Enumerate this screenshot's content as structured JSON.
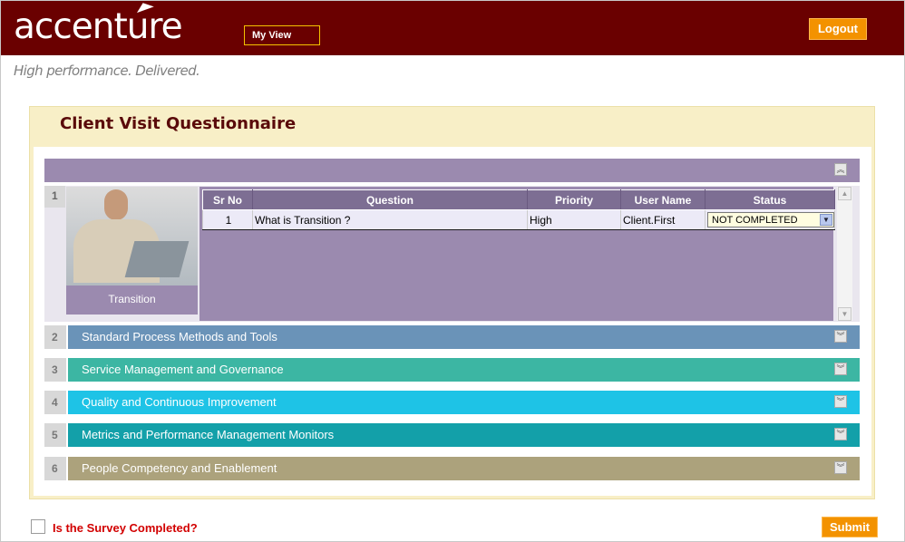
{
  "header": {
    "logo_text": "accenture",
    "my_view_label": "My View",
    "logout_label": "Logout",
    "tagline": "High performance. Delivered."
  },
  "panel": {
    "title": "Client Visit Questionnaire"
  },
  "section1": {
    "number": "1",
    "image_caption": "Transition",
    "collapse_icon": "chevron-up-icon",
    "table": {
      "columns": [
        "Sr No",
        "Question",
        "Priority",
        "User Name",
        "Status"
      ],
      "rows": [
        {
          "sr_no": "1",
          "question": "What is Transition ?",
          "priority": "High",
          "user_name": "Client.First",
          "status": "NOT COMPLETED"
        }
      ]
    }
  },
  "sections": [
    {
      "number": "2",
      "title": "Standard Process Methods and Tools",
      "color": "#6a93b8"
    },
    {
      "number": "3",
      "title": "Service Management and Governance",
      "color": "#3cb6a3"
    },
    {
      "number": "4",
      "title": "Quality and Continuous Improvement",
      "color": "#1ec3e6"
    },
    {
      "number": "5",
      "title": "Metrics and Performance Management Monitors",
      "color": "#13a0a9"
    },
    {
      "number": "6",
      "title": "People Competency and Enablement",
      "color": "#aca27c"
    }
  ],
  "footer": {
    "survey_label": "Is the Survey Completed?",
    "submit_label": "Submit"
  },
  "colors": {
    "header_bg": "#6a0000",
    "button_orange": "#f39200",
    "section1_purple": "#9b8aaf"
  }
}
